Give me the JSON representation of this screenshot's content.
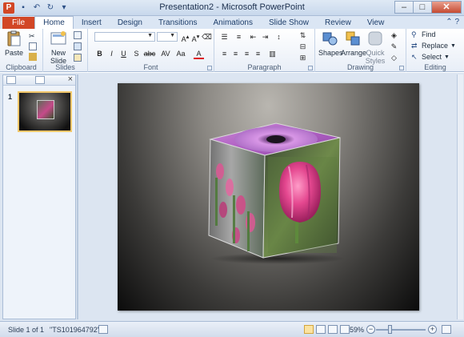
{
  "window": {
    "title": "Presentation2 - Microsoft PowerPoint",
    "app_icon_letter": "P"
  },
  "tabs": [
    {
      "label": "File"
    },
    {
      "label": "Home"
    },
    {
      "label": "Insert"
    },
    {
      "label": "Design"
    },
    {
      "label": "Transitions"
    },
    {
      "label": "Animations"
    },
    {
      "label": "Slide Show"
    },
    {
      "label": "Review"
    },
    {
      "label": "View"
    }
  ],
  "ribbon": {
    "clipboard": {
      "label": "Clipboard",
      "paste": "Paste"
    },
    "slides": {
      "label": "Slides",
      "new_slide": "New Slide"
    },
    "font": {
      "label": "Font",
      "bold": "B",
      "italic": "I",
      "underline": "U",
      "strike": "S",
      "shadow": "abc",
      "spacing": "AV",
      "case": "Aa",
      "color": "A"
    },
    "paragraph": {
      "label": "Paragraph"
    },
    "drawing": {
      "label": "Drawing",
      "shapes": "Shapes",
      "arrange": "Arrange",
      "quick_styles": "Quick Styles"
    },
    "editing": {
      "label": "Editing",
      "find": "Find",
      "replace": "Replace",
      "select": "Select"
    }
  },
  "thumbnails": {
    "slide_number": "1"
  },
  "statusbar": {
    "slide_info": "Slide 1 of 1",
    "theme": "\"TS101964792\"",
    "zoom": "59%",
    "minus": "−",
    "plus": "+"
  },
  "colors": {
    "file_tab": "#d24726",
    "accent": "#2b4f85"
  }
}
